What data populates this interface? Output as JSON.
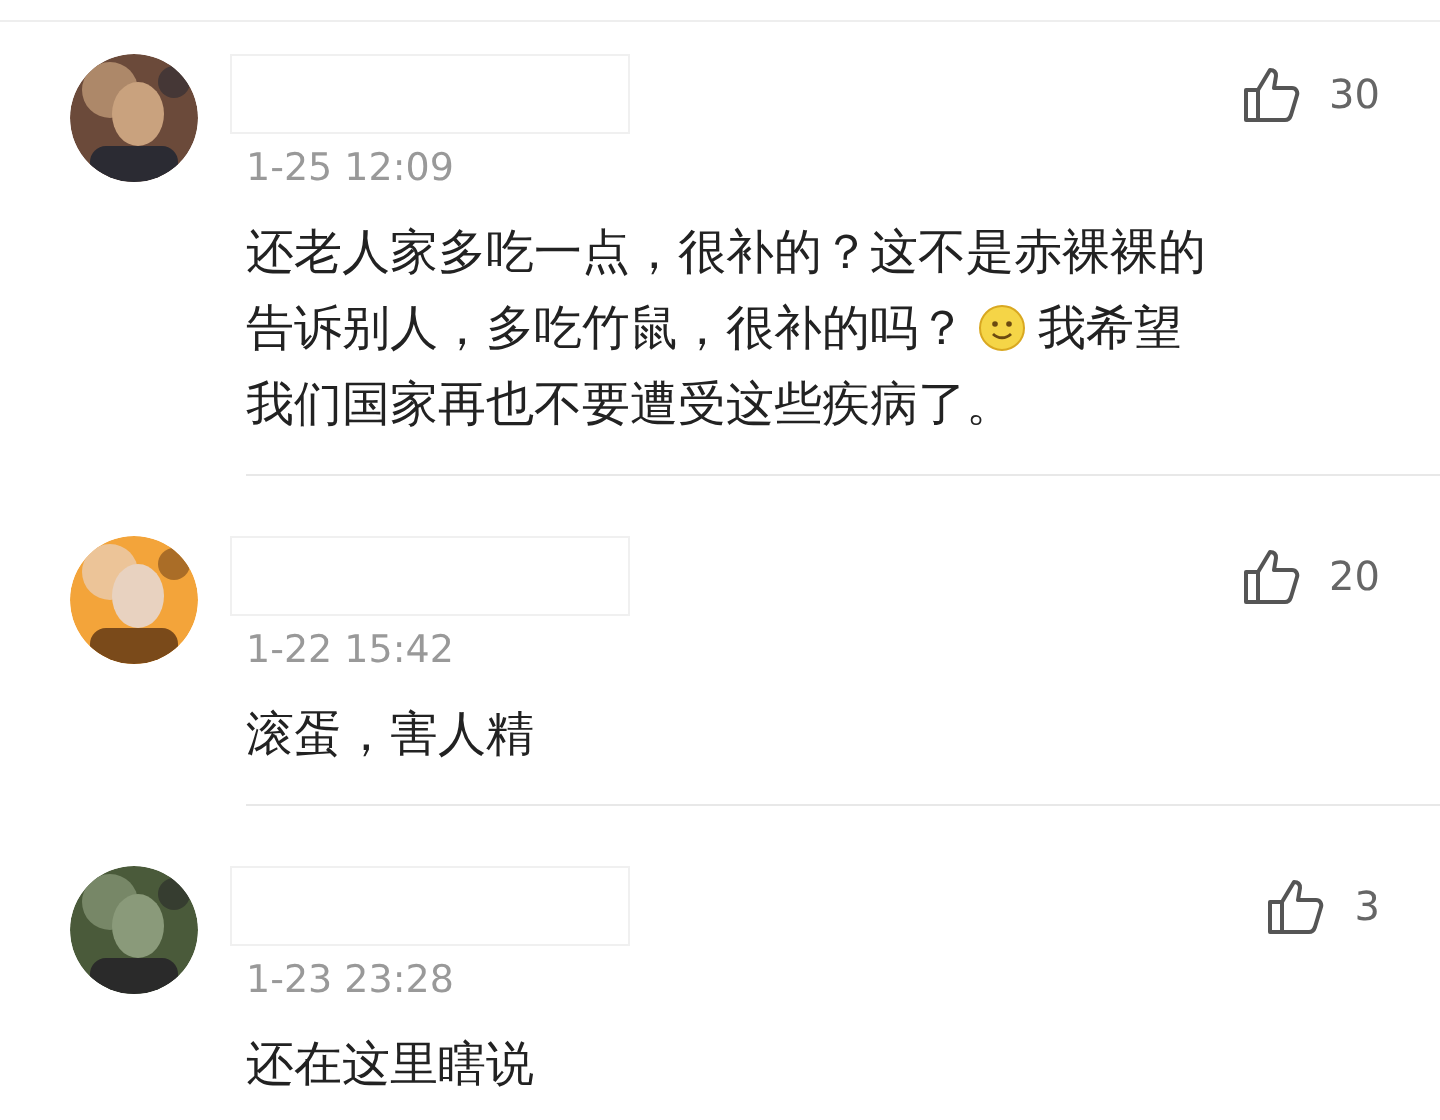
{
  "comments": [
    {
      "name_redacted": true,
      "likes": "30",
      "time": "1-25 12:09",
      "lines": [
        {
          "segments": [
            {
              "kind": "text",
              "text": "还老人家多吃一点，很补的？这不是赤裸裸的"
            }
          ]
        },
        {
          "segments": [
            {
              "kind": "text",
              "text": "告诉别人，多吃竹鼠，很补的吗？"
            },
            {
              "kind": "emoji"
            },
            {
              "kind": "text",
              "text": "我希望"
            }
          ]
        },
        {
          "segments": [
            {
              "kind": "text",
              "text": "我们国家再也不要遭受这些疾病了。"
            }
          ]
        }
      ]
    },
    {
      "name_redacted": true,
      "likes": "20",
      "time": "1-22 15:42",
      "lines": [
        {
          "segments": [
            {
              "kind": "text",
              "text": "滚蛋，害人精"
            }
          ]
        }
      ]
    },
    {
      "name_redacted": true,
      "likes": "3",
      "time": "1-23 23:28",
      "lines": [
        {
          "segments": [
            {
              "kind": "text",
              "text": "还在这里瞎说"
            }
          ]
        }
      ]
    }
  ]
}
